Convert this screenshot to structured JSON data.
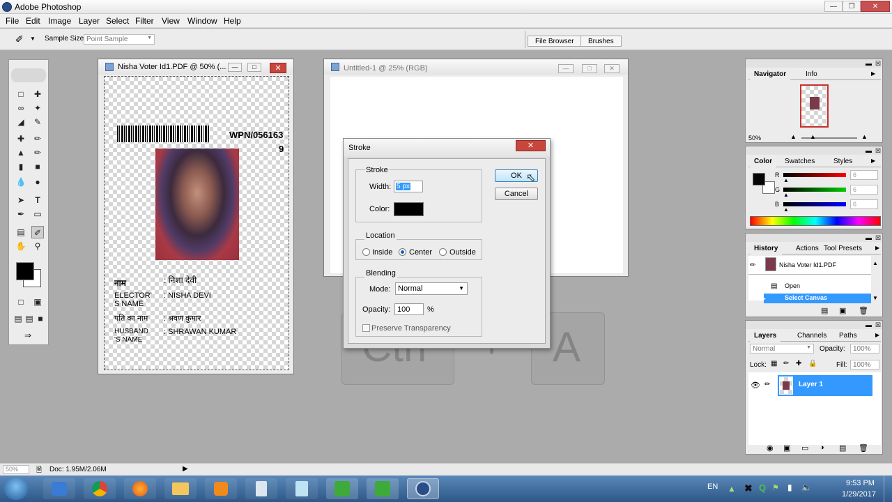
{
  "app": {
    "title": "Adobe Photoshop"
  },
  "menu": [
    "File",
    "Edit",
    "Image",
    "Layer",
    "Select",
    "Filter",
    "View",
    "Window",
    "Help"
  ],
  "options": {
    "sample_size_label": "Sample Size:",
    "sample_size_value": "Point Sample",
    "file_browser": "File Browser",
    "brushes": "Brushes"
  },
  "doc1": {
    "title": "Nisha Voter Id1.PDF @ 50% (...",
    "card": {
      "wpn": "WPN/056163",
      "wpn2": "9",
      "label_name_hi": "नाम",
      "value_name_hi": ": निशा देवी",
      "label_elector": "ELECTOR'",
      "label_elector2": "S NAME",
      "value_elector": ": NISHA DEVI",
      "label_father_hi": "पति का नाम",
      "value_father_hi": ": श्रवण कुमार",
      "label_husband": "HUSBAND",
      "label_husband2": "'S NAME",
      "value_husband": ": SHRAWAN KUMAR"
    }
  },
  "doc2": {
    "title": "Untitled-1 @ 25% (RGB)"
  },
  "dialog": {
    "title": "Stroke",
    "stroke_group": "Stroke",
    "width_label": "Width:",
    "width_value": "5 px",
    "color_label": "Color:",
    "stroke_color": "#000000",
    "location_group": "Location",
    "loc_inside": "Inside",
    "loc_center": "Center",
    "loc_outside": "Outside",
    "blending_group": "Blending",
    "mode_label": "Mode:",
    "mode_value": "Normal",
    "opacity_label": "Opacity:",
    "opacity_value": "100",
    "opacity_unit": "%",
    "preserve_label": "Preserve Transparency",
    "ok": "OK",
    "cancel": "Cancel"
  },
  "overlay_keys": {
    "ctrl": "Ctrl",
    "plus": "+",
    "a": "A"
  },
  "navigator": {
    "tab1": "Navigator",
    "tab2": "Info",
    "zoom": "50%"
  },
  "color_panel": {
    "tab1": "Color",
    "tab2": "Swatches",
    "tab3": "Styles",
    "r_label": "R",
    "g_label": "G",
    "b_label": "B",
    "r_value": "6",
    "g_value": "6",
    "b_value": "6",
    "fg_color": "#060606"
  },
  "history": {
    "tab1": "History",
    "tab2": "Actions",
    "tab3": "Tool Presets",
    "snapshot": "Nisha Voter Id1.PDF",
    "items": [
      "Open",
      "Select Canvas"
    ]
  },
  "layers": {
    "tab1": "Layers",
    "tab2": "Channels",
    "tab3": "Paths",
    "blend_mode": "Normal",
    "opacity_label": "Opacity:",
    "opacity_value": "100%",
    "lock_label": "Lock:",
    "fill_label": "Fill:",
    "fill_value": "100%",
    "layer_name": "Layer 1"
  },
  "status": {
    "zoom": "50%",
    "doc": "Doc: 1.95M/2.06M"
  },
  "taskbar": {
    "lang": "EN",
    "time": "9:53 PM",
    "date": "1/29/2017"
  }
}
